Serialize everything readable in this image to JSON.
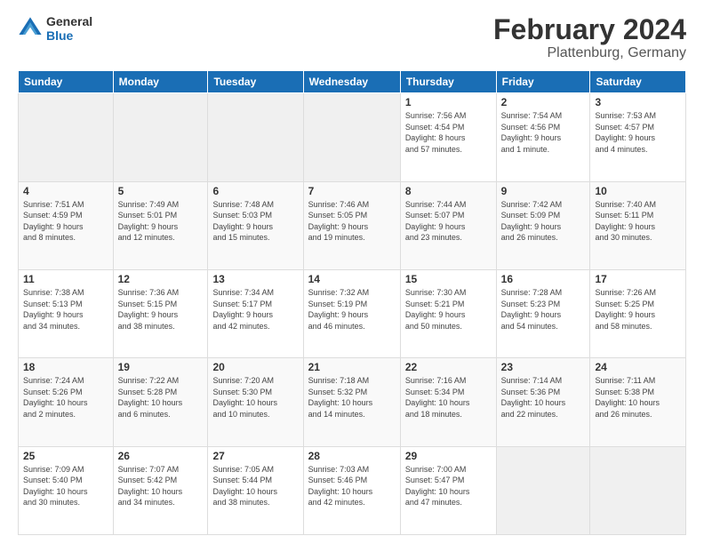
{
  "logo": {
    "line1": "General",
    "line2": "Blue"
  },
  "title": "February 2024",
  "subtitle": "Plattenburg, Germany",
  "days_of_week": [
    "Sunday",
    "Monday",
    "Tuesday",
    "Wednesday",
    "Thursday",
    "Friday",
    "Saturday"
  ],
  "weeks": [
    [
      {
        "day": "",
        "info": ""
      },
      {
        "day": "",
        "info": ""
      },
      {
        "day": "",
        "info": ""
      },
      {
        "day": "",
        "info": ""
      },
      {
        "day": "1",
        "info": "Sunrise: 7:56 AM\nSunset: 4:54 PM\nDaylight: 8 hours\nand 57 minutes."
      },
      {
        "day": "2",
        "info": "Sunrise: 7:54 AM\nSunset: 4:56 PM\nDaylight: 9 hours\nand 1 minute."
      },
      {
        "day": "3",
        "info": "Sunrise: 7:53 AM\nSunset: 4:57 PM\nDaylight: 9 hours\nand 4 minutes."
      }
    ],
    [
      {
        "day": "4",
        "info": "Sunrise: 7:51 AM\nSunset: 4:59 PM\nDaylight: 9 hours\nand 8 minutes."
      },
      {
        "day": "5",
        "info": "Sunrise: 7:49 AM\nSunset: 5:01 PM\nDaylight: 9 hours\nand 12 minutes."
      },
      {
        "day": "6",
        "info": "Sunrise: 7:48 AM\nSunset: 5:03 PM\nDaylight: 9 hours\nand 15 minutes."
      },
      {
        "day": "7",
        "info": "Sunrise: 7:46 AM\nSunset: 5:05 PM\nDaylight: 9 hours\nand 19 minutes."
      },
      {
        "day": "8",
        "info": "Sunrise: 7:44 AM\nSunset: 5:07 PM\nDaylight: 9 hours\nand 23 minutes."
      },
      {
        "day": "9",
        "info": "Sunrise: 7:42 AM\nSunset: 5:09 PM\nDaylight: 9 hours\nand 26 minutes."
      },
      {
        "day": "10",
        "info": "Sunrise: 7:40 AM\nSunset: 5:11 PM\nDaylight: 9 hours\nand 30 minutes."
      }
    ],
    [
      {
        "day": "11",
        "info": "Sunrise: 7:38 AM\nSunset: 5:13 PM\nDaylight: 9 hours\nand 34 minutes."
      },
      {
        "day": "12",
        "info": "Sunrise: 7:36 AM\nSunset: 5:15 PM\nDaylight: 9 hours\nand 38 minutes."
      },
      {
        "day": "13",
        "info": "Sunrise: 7:34 AM\nSunset: 5:17 PM\nDaylight: 9 hours\nand 42 minutes."
      },
      {
        "day": "14",
        "info": "Sunrise: 7:32 AM\nSunset: 5:19 PM\nDaylight: 9 hours\nand 46 minutes."
      },
      {
        "day": "15",
        "info": "Sunrise: 7:30 AM\nSunset: 5:21 PM\nDaylight: 9 hours\nand 50 minutes."
      },
      {
        "day": "16",
        "info": "Sunrise: 7:28 AM\nSunset: 5:23 PM\nDaylight: 9 hours\nand 54 minutes."
      },
      {
        "day": "17",
        "info": "Sunrise: 7:26 AM\nSunset: 5:25 PM\nDaylight: 9 hours\nand 58 minutes."
      }
    ],
    [
      {
        "day": "18",
        "info": "Sunrise: 7:24 AM\nSunset: 5:26 PM\nDaylight: 10 hours\nand 2 minutes."
      },
      {
        "day": "19",
        "info": "Sunrise: 7:22 AM\nSunset: 5:28 PM\nDaylight: 10 hours\nand 6 minutes."
      },
      {
        "day": "20",
        "info": "Sunrise: 7:20 AM\nSunset: 5:30 PM\nDaylight: 10 hours\nand 10 minutes."
      },
      {
        "day": "21",
        "info": "Sunrise: 7:18 AM\nSunset: 5:32 PM\nDaylight: 10 hours\nand 14 minutes."
      },
      {
        "day": "22",
        "info": "Sunrise: 7:16 AM\nSunset: 5:34 PM\nDaylight: 10 hours\nand 18 minutes."
      },
      {
        "day": "23",
        "info": "Sunrise: 7:14 AM\nSunset: 5:36 PM\nDaylight: 10 hours\nand 22 minutes."
      },
      {
        "day": "24",
        "info": "Sunrise: 7:11 AM\nSunset: 5:38 PM\nDaylight: 10 hours\nand 26 minutes."
      }
    ],
    [
      {
        "day": "25",
        "info": "Sunrise: 7:09 AM\nSunset: 5:40 PM\nDaylight: 10 hours\nand 30 minutes."
      },
      {
        "day": "26",
        "info": "Sunrise: 7:07 AM\nSunset: 5:42 PM\nDaylight: 10 hours\nand 34 minutes."
      },
      {
        "day": "27",
        "info": "Sunrise: 7:05 AM\nSunset: 5:44 PM\nDaylight: 10 hours\nand 38 minutes."
      },
      {
        "day": "28",
        "info": "Sunrise: 7:03 AM\nSunset: 5:46 PM\nDaylight: 10 hours\nand 42 minutes."
      },
      {
        "day": "29",
        "info": "Sunrise: 7:00 AM\nSunset: 5:47 PM\nDaylight: 10 hours\nand 47 minutes."
      },
      {
        "day": "",
        "info": ""
      },
      {
        "day": "",
        "info": ""
      }
    ]
  ]
}
